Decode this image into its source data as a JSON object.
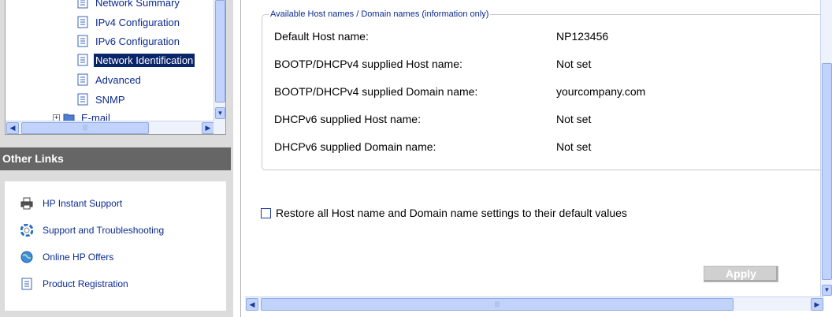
{
  "nav_tree": {
    "items": [
      {
        "label": "Network Summary"
      },
      {
        "label": "IPv4 Configuration"
      },
      {
        "label": "IPv6 Configuration"
      },
      {
        "label": "Network Identification",
        "selected": true
      },
      {
        "label": "Advanced"
      },
      {
        "label": "SNMP"
      },
      {
        "label": "E-mail"
      }
    ]
  },
  "other_links": {
    "header": "Other Links",
    "items": [
      {
        "label": "HP Instant Support",
        "icon": "printer-icon"
      },
      {
        "label": "Support and Troubleshooting",
        "icon": "lifebuoy-icon"
      },
      {
        "label": "Online HP Offers",
        "icon": "globe-icon"
      },
      {
        "label": "Product Registration",
        "icon": "document-icon"
      }
    ]
  },
  "host_section": {
    "legend": "Available Host names / Domain names (information only)",
    "rows": [
      {
        "label": "Default Host name:",
        "value": "NP123456"
      },
      {
        "label": "BOOTP/DHCPv4 supplied Host name:",
        "value": "Not set"
      },
      {
        "label": "BOOTP/DHCPv4 supplied Domain name:",
        "value": "yourcompany.com"
      },
      {
        "label": "DHCPv6 supplied Host name:",
        "value": "Not set"
      },
      {
        "label": "DHCPv6 supplied Domain name:",
        "value": "Not set"
      }
    ]
  },
  "restore_checkbox": {
    "label": "Restore all Host name and Domain name settings to their default values",
    "checked": false
  },
  "apply_button": {
    "label": "Apply",
    "enabled": false
  },
  "colors": {
    "selection": "#0a246a",
    "link": "#0a2a8e",
    "header_bg": "#666666",
    "scrollbar": "#c2d3fb"
  }
}
